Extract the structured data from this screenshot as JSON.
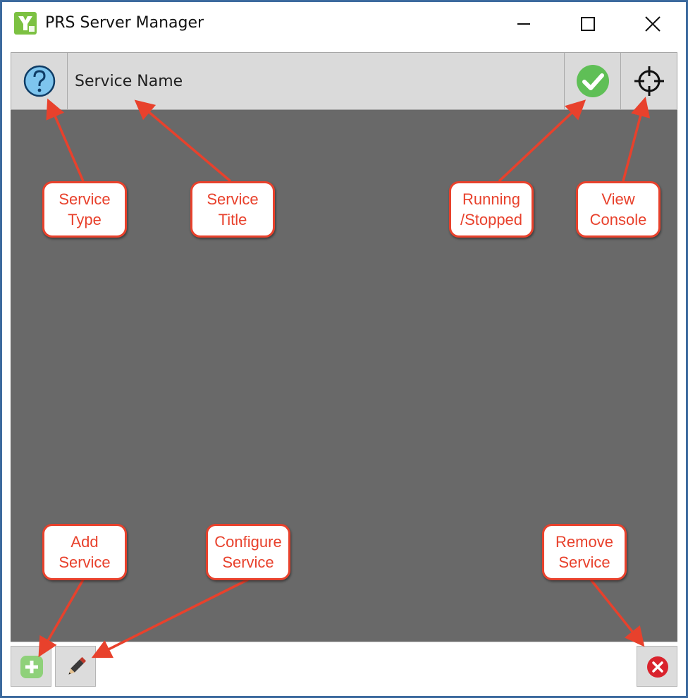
{
  "window": {
    "title": "PRS Server Manager",
    "controls": {
      "minimize_icon": "minimize-icon",
      "maximize_icon": "maximize-icon",
      "close_icon": "close-icon"
    }
  },
  "header": {
    "service_name": "Service Name",
    "type_icon": "help-icon",
    "status_icon": "check-icon",
    "console_icon": "crosshair-icon"
  },
  "footer": {
    "add_icon": "plus-icon",
    "configure_icon": "pencil-icon",
    "remove_icon": "remove-icon"
  },
  "callouts": {
    "service_type": "Service\nType",
    "service_title": "Service\nTitle",
    "running_stopped": "Running\n/Stopped",
    "view_console": "View\nConsole",
    "add_service": "Add\nService",
    "configure_service": "Configure\nService",
    "remove_service": "Remove\nService"
  },
  "colors": {
    "frame": "#3c6a9e",
    "callout": "#e8412c",
    "panel": "#696969",
    "header": "#dadada"
  }
}
